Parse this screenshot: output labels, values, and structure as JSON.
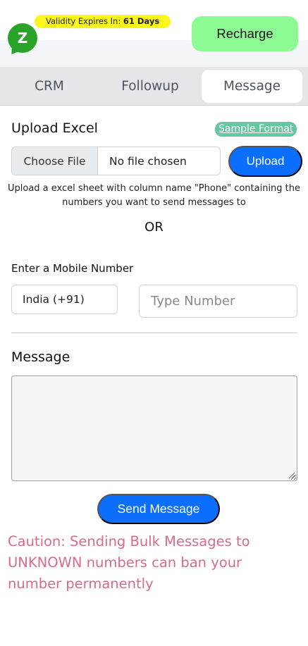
{
  "header": {
    "logo_letter": "Z",
    "validity_prefix": "Validity Expires In: ",
    "validity_value": "61 Days",
    "recharge_label": "Recharge"
  },
  "tabs": [
    {
      "label": "CRM",
      "active": false
    },
    {
      "label": "Followup",
      "active": false
    },
    {
      "label": "Message",
      "active": true
    }
  ],
  "upload": {
    "title": "Upload Excel",
    "sample_link": "Sample Format",
    "choose_file_label": "Choose File",
    "file_status": "No file chosen",
    "upload_label": "Upload",
    "help_text": "Upload a excel sheet with column name \"Phone\" containing the numbers you want to send messages to"
  },
  "or_text": "OR",
  "mobile": {
    "label": "Enter a Mobile Number",
    "country_value": "India (+91)",
    "number_placeholder": "Type Number",
    "number_value": ""
  },
  "message": {
    "label": "Message",
    "value": "",
    "send_label": "Send Message"
  },
  "caution_text": "Caution: Sending Bulk Messages to UNKNOWN numbers can ban your number permanently",
  "colors": {
    "primary_blue": "#0b6efd",
    "recharge_green": "#8dfb93",
    "validity_yellow": "#fbf61d",
    "sample_link_green": "#63c7a0",
    "caution_pink": "#d96a8b",
    "logo_green": "#29a329"
  },
  "icons": {
    "logo": "whatsapp-style-chat-bubble-logo",
    "textarea_resize": "resize-grip-icon"
  }
}
